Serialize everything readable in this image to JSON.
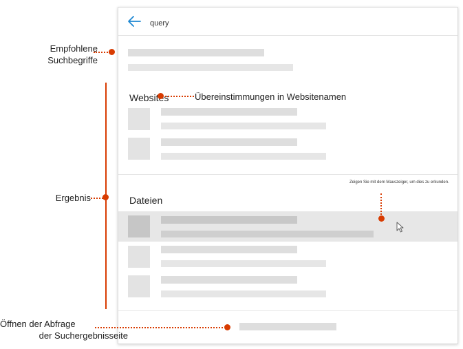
{
  "search": {
    "query": "query"
  },
  "sections": {
    "websites_title": "Websites",
    "files_title": "Dateien"
  },
  "callouts": {
    "suggested_searches": [
      "Empfohlene",
      "Suchbegriffe"
    ],
    "website_matches": "Übereinstimmungen in Websitenamen",
    "results": "Ergebnis",
    "hover_hint": "Zeigen Sie mit dem Mauszeiger, um dies zu erkunden.",
    "open_query": [
      "Öffnen der Abfrage",
      "der Suchergebnisseite"
    ]
  },
  "colors": {
    "accent": "#d83b01",
    "back_arrow": "#1e88d2",
    "hover_row": "#e7e7e7"
  },
  "icons": {
    "back": "back-arrow-icon",
    "cursor": "mouse-pointer-icon"
  }
}
